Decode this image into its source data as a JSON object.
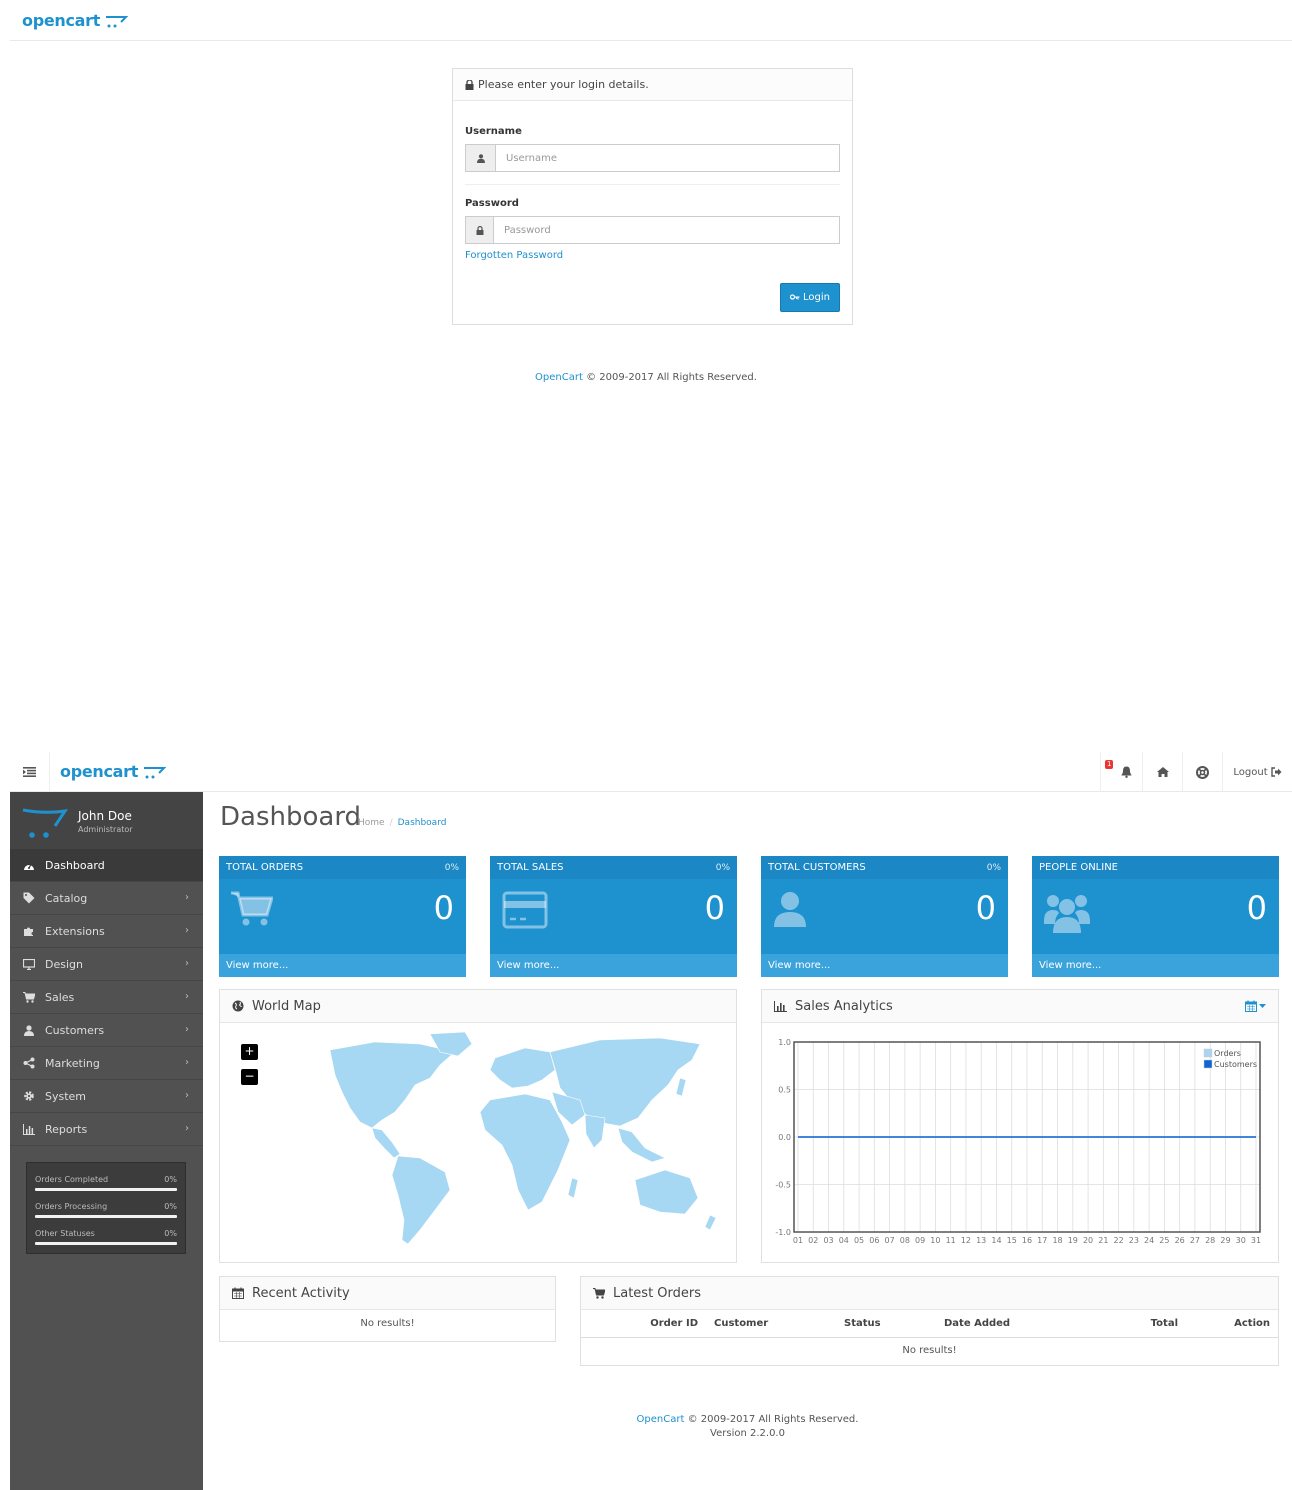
{
  "login": {
    "logo_text": "opencart",
    "panel_heading": "Please enter your login details.",
    "username_label": "Username",
    "username_placeholder": "Username",
    "password_label": "Password",
    "password_placeholder": "Password",
    "forgot_link": "Forgotten Password",
    "login_button": "Login",
    "footer_link": "OpenCart",
    "footer_text": "© 2009-2017 All Rights Reserved."
  },
  "dashboard": {
    "logo_text": "opencart",
    "header": {
      "notification_count": "1",
      "logout_label": "Logout"
    },
    "profile": {
      "name": "John Doe",
      "role": "Administrator"
    },
    "nav": [
      {
        "label": "Dashboard",
        "icon": "dashboard-icon",
        "active": true
      },
      {
        "label": "Catalog",
        "icon": "tag-icon"
      },
      {
        "label": "Extensions",
        "icon": "puzzle-icon"
      },
      {
        "label": "Design",
        "icon": "desktop-icon"
      },
      {
        "label": "Sales",
        "icon": "cart-icon"
      },
      {
        "label": "Customers",
        "icon": "user-icon"
      },
      {
        "label": "Marketing",
        "icon": "share-icon"
      },
      {
        "label": "System",
        "icon": "gear-icon"
      },
      {
        "label": "Reports",
        "icon": "bar-chart-icon"
      }
    ],
    "order_status": [
      {
        "label": "Orders Completed",
        "value": "0%",
        "fraction": 0
      },
      {
        "label": "Orders Processing",
        "value": "0%",
        "fraction": 0
      },
      {
        "label": "Other Statuses",
        "value": "0%",
        "fraction": 0
      }
    ],
    "title": "Dashboard",
    "breadcrumb": {
      "home": "Home",
      "separator": "/",
      "current": "Dashboard"
    },
    "tiles": [
      {
        "title": "TOTAL ORDERS",
        "percent": "0%",
        "value": "0",
        "footer": "View more...",
        "icon": "cart-icon"
      },
      {
        "title": "TOTAL SALES",
        "percent": "0%",
        "value": "0",
        "footer": "View more...",
        "icon": "credit-card-icon"
      },
      {
        "title": "TOTAL CUSTOMERS",
        "percent": "0%",
        "value": "0",
        "footer": "View more...",
        "icon": "user-icon"
      },
      {
        "title": "PEOPLE ONLINE",
        "percent": "",
        "value": "0",
        "footer": "View more...",
        "icon": "users-icon"
      }
    ],
    "world_map": {
      "title": "World Map",
      "zoom_in": "+",
      "zoom_out": "−"
    },
    "sales_analytics": {
      "title": "Sales Analytics"
    },
    "recent_activity": {
      "title": "Recent Activity",
      "empty": "No results!"
    },
    "latest_orders": {
      "title": "Latest Orders",
      "columns": [
        "Order ID",
        "Customer",
        "Status",
        "Date Added",
        "Total",
        "Action"
      ],
      "empty": "No results!"
    },
    "footer": {
      "link": "OpenCart",
      "text": "© 2009-2017 All Rights Reserved.",
      "version": "Version 2.2.0.0"
    }
  },
  "colors": {
    "brand_blue": "#1e91cf",
    "sidebar_bg": "#515151",
    "map_land": "#a6d8f3",
    "orders_series": "#aad4f0",
    "customers_series": "#1065d4"
  },
  "chart_data": {
    "type": "line",
    "x": [
      "01",
      "02",
      "03",
      "04",
      "05",
      "06",
      "07",
      "08",
      "09",
      "10",
      "11",
      "12",
      "13",
      "14",
      "15",
      "16",
      "17",
      "18",
      "19",
      "20",
      "21",
      "22",
      "23",
      "24",
      "25",
      "26",
      "27",
      "28",
      "29",
      "30",
      "31"
    ],
    "series": [
      {
        "name": "Orders",
        "values": [
          0,
          0,
          0,
          0,
          0,
          0,
          0,
          0,
          0,
          0,
          0,
          0,
          0,
          0,
          0,
          0,
          0,
          0,
          0,
          0,
          0,
          0,
          0,
          0,
          0,
          0,
          0,
          0,
          0,
          0,
          0
        ]
      },
      {
        "name": "Customers",
        "values": [
          0,
          0,
          0,
          0,
          0,
          0,
          0,
          0,
          0,
          0,
          0,
          0,
          0,
          0,
          0,
          0,
          0,
          0,
          0,
          0,
          0,
          0,
          0,
          0,
          0,
          0,
          0,
          0,
          0,
          0,
          0
        ]
      }
    ],
    "y_ticks": [
      "1.0",
      "0.5",
      "0.0",
      "-0.5",
      "-1.0"
    ],
    "ylim": [
      -1.0,
      1.0
    ],
    "grid": true,
    "legend": "top-right"
  }
}
